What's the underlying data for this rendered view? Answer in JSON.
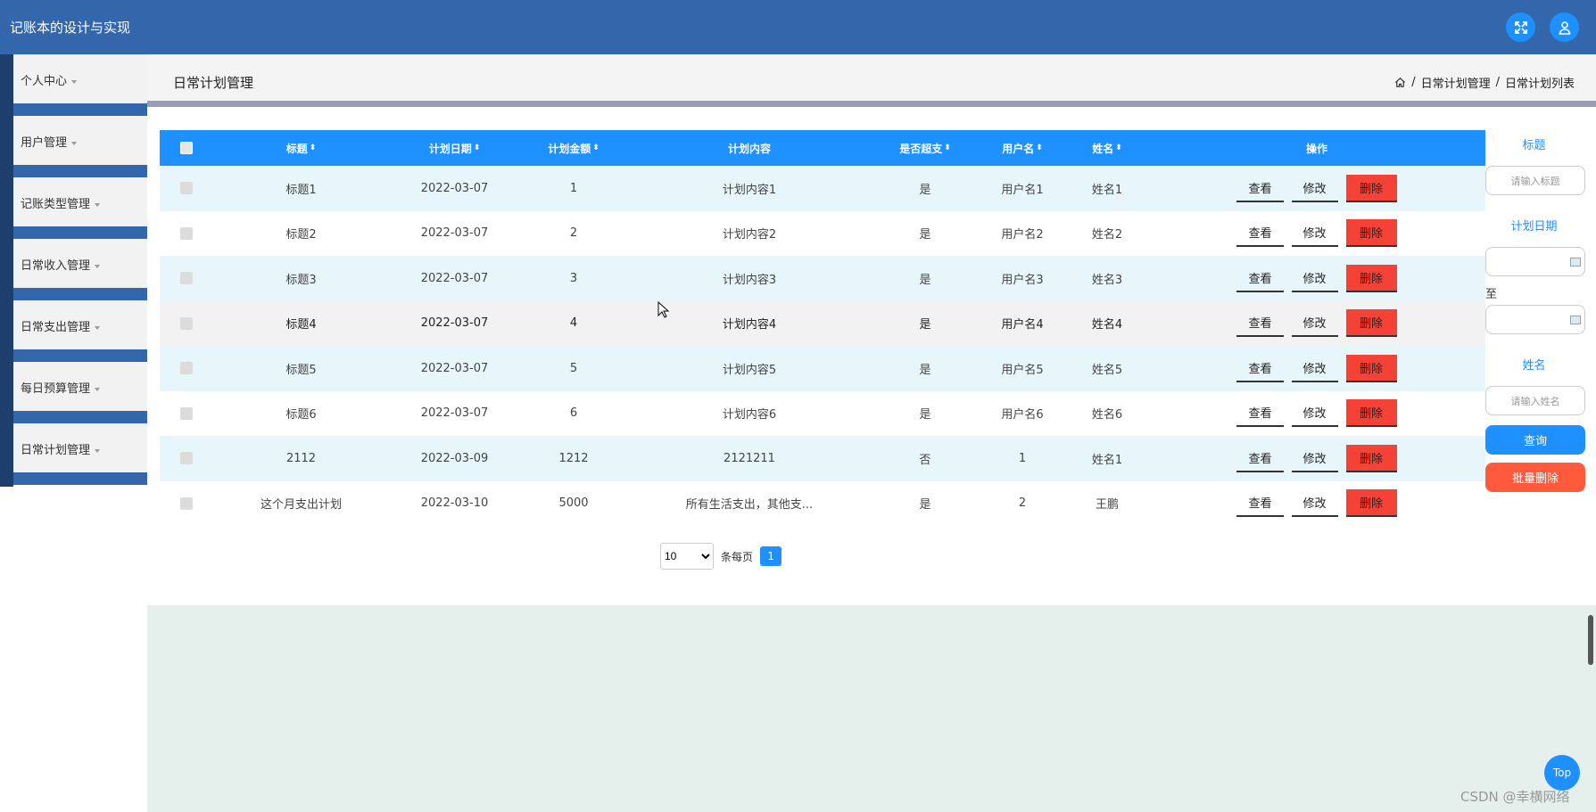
{
  "app": {
    "title": "记账本的设计与实现"
  },
  "top_icons": [
    "fullscreen-icon",
    "user-icon"
  ],
  "sidebar": {
    "items": [
      {
        "label": "个人中心"
      },
      {
        "label": "用户管理"
      },
      {
        "label": "记账类型管理"
      },
      {
        "label": "日常收入管理"
      },
      {
        "label": "日常支出管理"
      },
      {
        "label": "每日预算管理"
      },
      {
        "label": "日常计划管理"
      }
    ]
  },
  "header": {
    "page_title": "日常计划管理",
    "breadcrumb": {
      "sep": "/",
      "level1": "日常计划管理",
      "level2": "日常计划列表"
    }
  },
  "table": {
    "columns": {
      "title": "标题",
      "date": "计划日期",
      "amount": "计划金额",
      "content": "计划内容",
      "over": "是否超支",
      "username": "用户名",
      "name": "姓名",
      "actions": "操作"
    },
    "rows": [
      {
        "title": "标题1",
        "date": "2022-03-07",
        "amount": "1",
        "content": "计划内容1",
        "over": "是",
        "username": "用户名1",
        "name": "姓名1"
      },
      {
        "title": "标题2",
        "date": "2022-03-07",
        "amount": "2",
        "content": "计划内容2",
        "over": "是",
        "username": "用户名2",
        "name": "姓名2"
      },
      {
        "title": "标题3",
        "date": "2022-03-07",
        "amount": "3",
        "content": "计划内容3",
        "over": "是",
        "username": "用户名3",
        "name": "姓名3"
      },
      {
        "title": "标题4",
        "date": "2022-03-07",
        "amount": "4",
        "content": "计划内容4",
        "over": "是",
        "username": "用户名4",
        "name": "姓名4"
      },
      {
        "title": "标题5",
        "date": "2022-03-07",
        "amount": "5",
        "content": "计划内容5",
        "over": "是",
        "username": "用户名5",
        "name": "姓名5"
      },
      {
        "title": "标题6",
        "date": "2022-03-07",
        "amount": "6",
        "content": "计划内容6",
        "over": "是",
        "username": "用户名6",
        "name": "姓名6"
      },
      {
        "title": "2112",
        "date": "2022-03-09",
        "amount": "1212",
        "content": "2121211",
        "over": "否",
        "username": "1",
        "name": "姓名1"
      },
      {
        "title": "这个月支出计划",
        "date": "2022-03-10",
        "amount": "5000",
        "content": "所有生活支出，其他支...",
        "over": "是",
        "username": "2",
        "name": "王鹏"
      }
    ],
    "actions": {
      "view": "查看",
      "edit": "修改",
      "delete": "删除"
    }
  },
  "pagination": {
    "page_size": "10",
    "per_page_label": "条每页",
    "current_page": "1"
  },
  "search": {
    "title_label": "标题",
    "title_placeholder": "请输入标题",
    "date_label": "计划日期",
    "to_label": "至",
    "name_label": "姓名",
    "name_placeholder": "请输入姓名",
    "search_button": "查询",
    "batch_delete_button": "批量删除"
  },
  "colors": {
    "topbar": "#3366aa",
    "primary": "#1e90ff",
    "danger": "#f44336",
    "batch_delete": "#ff5a3c"
  },
  "top_button": "Top",
  "watermark": "CSDN @幸横网络"
}
